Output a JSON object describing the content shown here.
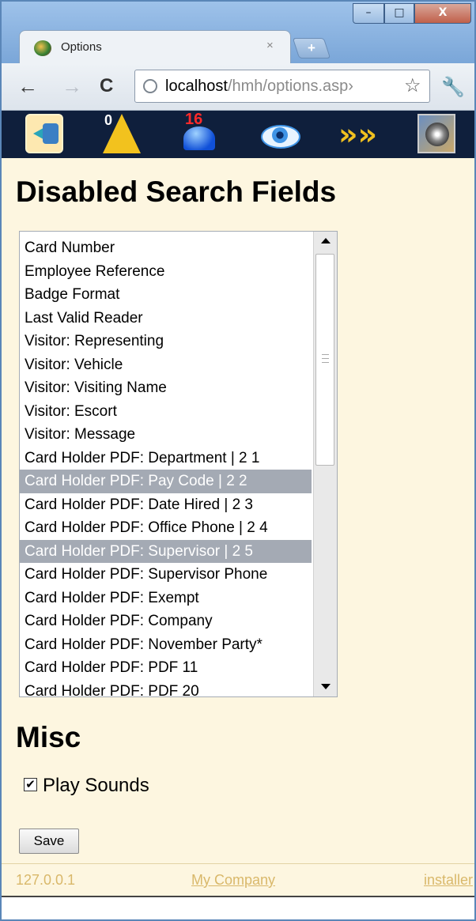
{
  "window": {
    "controls": {
      "minimize": "–",
      "maximize": "□",
      "close": "X"
    }
  },
  "tab": {
    "title": "Options",
    "close": "×",
    "new_tab": "+"
  },
  "toolbar": {
    "back": "←",
    "forward": "→",
    "reload": "C",
    "url_host": "localhost",
    "url_path": "/hmh/options.asp›",
    "star": "☆",
    "menu": "🔧"
  },
  "app_icons": {
    "badge_alerts": "0",
    "badge_alarms": "16",
    "icons": [
      "contacts-icon",
      "alert-triangle-icon",
      "alarm-light-icon",
      "eye-icon",
      "fast-forward-icon",
      "camera-icon"
    ]
  },
  "page": {
    "title": "Disabled Search Fields",
    "search_fields": [
      {
        "label": "Card Number",
        "selected": false
      },
      {
        "label": "Employee Reference",
        "selected": false
      },
      {
        "label": "Badge Format",
        "selected": false
      },
      {
        "label": "Last Valid Reader",
        "selected": false
      },
      {
        "label": "Visitor: Representing",
        "selected": false
      },
      {
        "label": "Visitor: Vehicle",
        "selected": false
      },
      {
        "label": "Visitor: Visiting Name",
        "selected": false
      },
      {
        "label": "Visitor: Escort",
        "selected": false
      },
      {
        "label": "Visitor: Message",
        "selected": false
      },
      {
        "label": "Card Holder PDF: Department | 2 1",
        "selected": false
      },
      {
        "label": "Card Holder PDF: Pay Code | 2 2",
        "selected": true
      },
      {
        "label": "Card Holder PDF: Date Hired | 2 3",
        "selected": false
      },
      {
        "label": "Card Holder PDF: Office Phone | 2 4",
        "selected": false
      },
      {
        "label": "Card Holder PDF: Supervisor | 2 5",
        "selected": true
      },
      {
        "label": "Card Holder PDF: Supervisor Phone",
        "selected": false
      },
      {
        "label": "Card Holder PDF: Exempt",
        "selected": false
      },
      {
        "label": "Card Holder PDF: Company",
        "selected": false
      },
      {
        "label": "Card Holder PDF: November Party*",
        "selected": false
      },
      {
        "label": "Card Holder PDF: PDF 11",
        "selected": false
      },
      {
        "label": "Card Holder PDF: PDF 20",
        "selected": false
      }
    ],
    "selected_bg": "#a4aab4"
  },
  "misc": {
    "title": "Misc",
    "play_sounds_label": "Play Sounds",
    "play_sounds_checked": true,
    "check_mark": "✔"
  },
  "save_label": "Save",
  "footer": {
    "ip": "127.0.0.1",
    "company": "My Company",
    "user": "installer",
    "link_color": "#d9b86a"
  },
  "colors": {
    "page_bg": "#fdf6e0",
    "iconbar_bg": "#0f1f3c"
  }
}
